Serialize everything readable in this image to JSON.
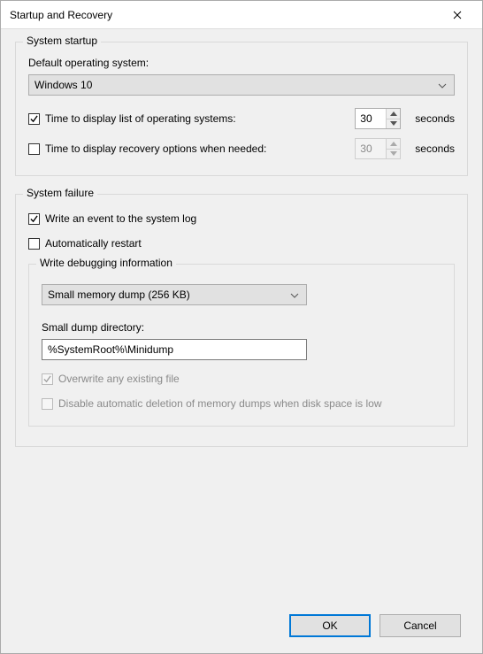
{
  "window": {
    "title": "Startup and Recovery"
  },
  "startup": {
    "group_label": "System startup",
    "default_os_label": "Default operating system:",
    "default_os_value": "Windows 10",
    "display_list": {
      "label": "Time to display list of operating systems:",
      "checked": true,
      "value": "30",
      "unit": "seconds"
    },
    "display_recovery": {
      "label": "Time to display recovery options when needed:",
      "checked": false,
      "value": "30",
      "unit": "seconds",
      "enabled": false
    }
  },
  "failure": {
    "group_label": "System failure",
    "write_event": {
      "label": "Write an event to the system log",
      "checked": true
    },
    "auto_restart": {
      "label": "Automatically restart",
      "checked": false
    },
    "debug": {
      "group_label": "Write debugging information",
      "dump_type": "Small memory dump (256 KB)",
      "dir_label": "Small dump directory:",
      "dir_value": "%SystemRoot%\\Minidump",
      "overwrite": {
        "label": "Overwrite any existing file",
        "checked": true,
        "enabled": false
      },
      "disable_delete": {
        "label": "Disable automatic deletion of memory dumps when disk space is low",
        "checked": false,
        "enabled": false
      }
    }
  },
  "buttons": {
    "ok": "OK",
    "cancel": "Cancel"
  }
}
